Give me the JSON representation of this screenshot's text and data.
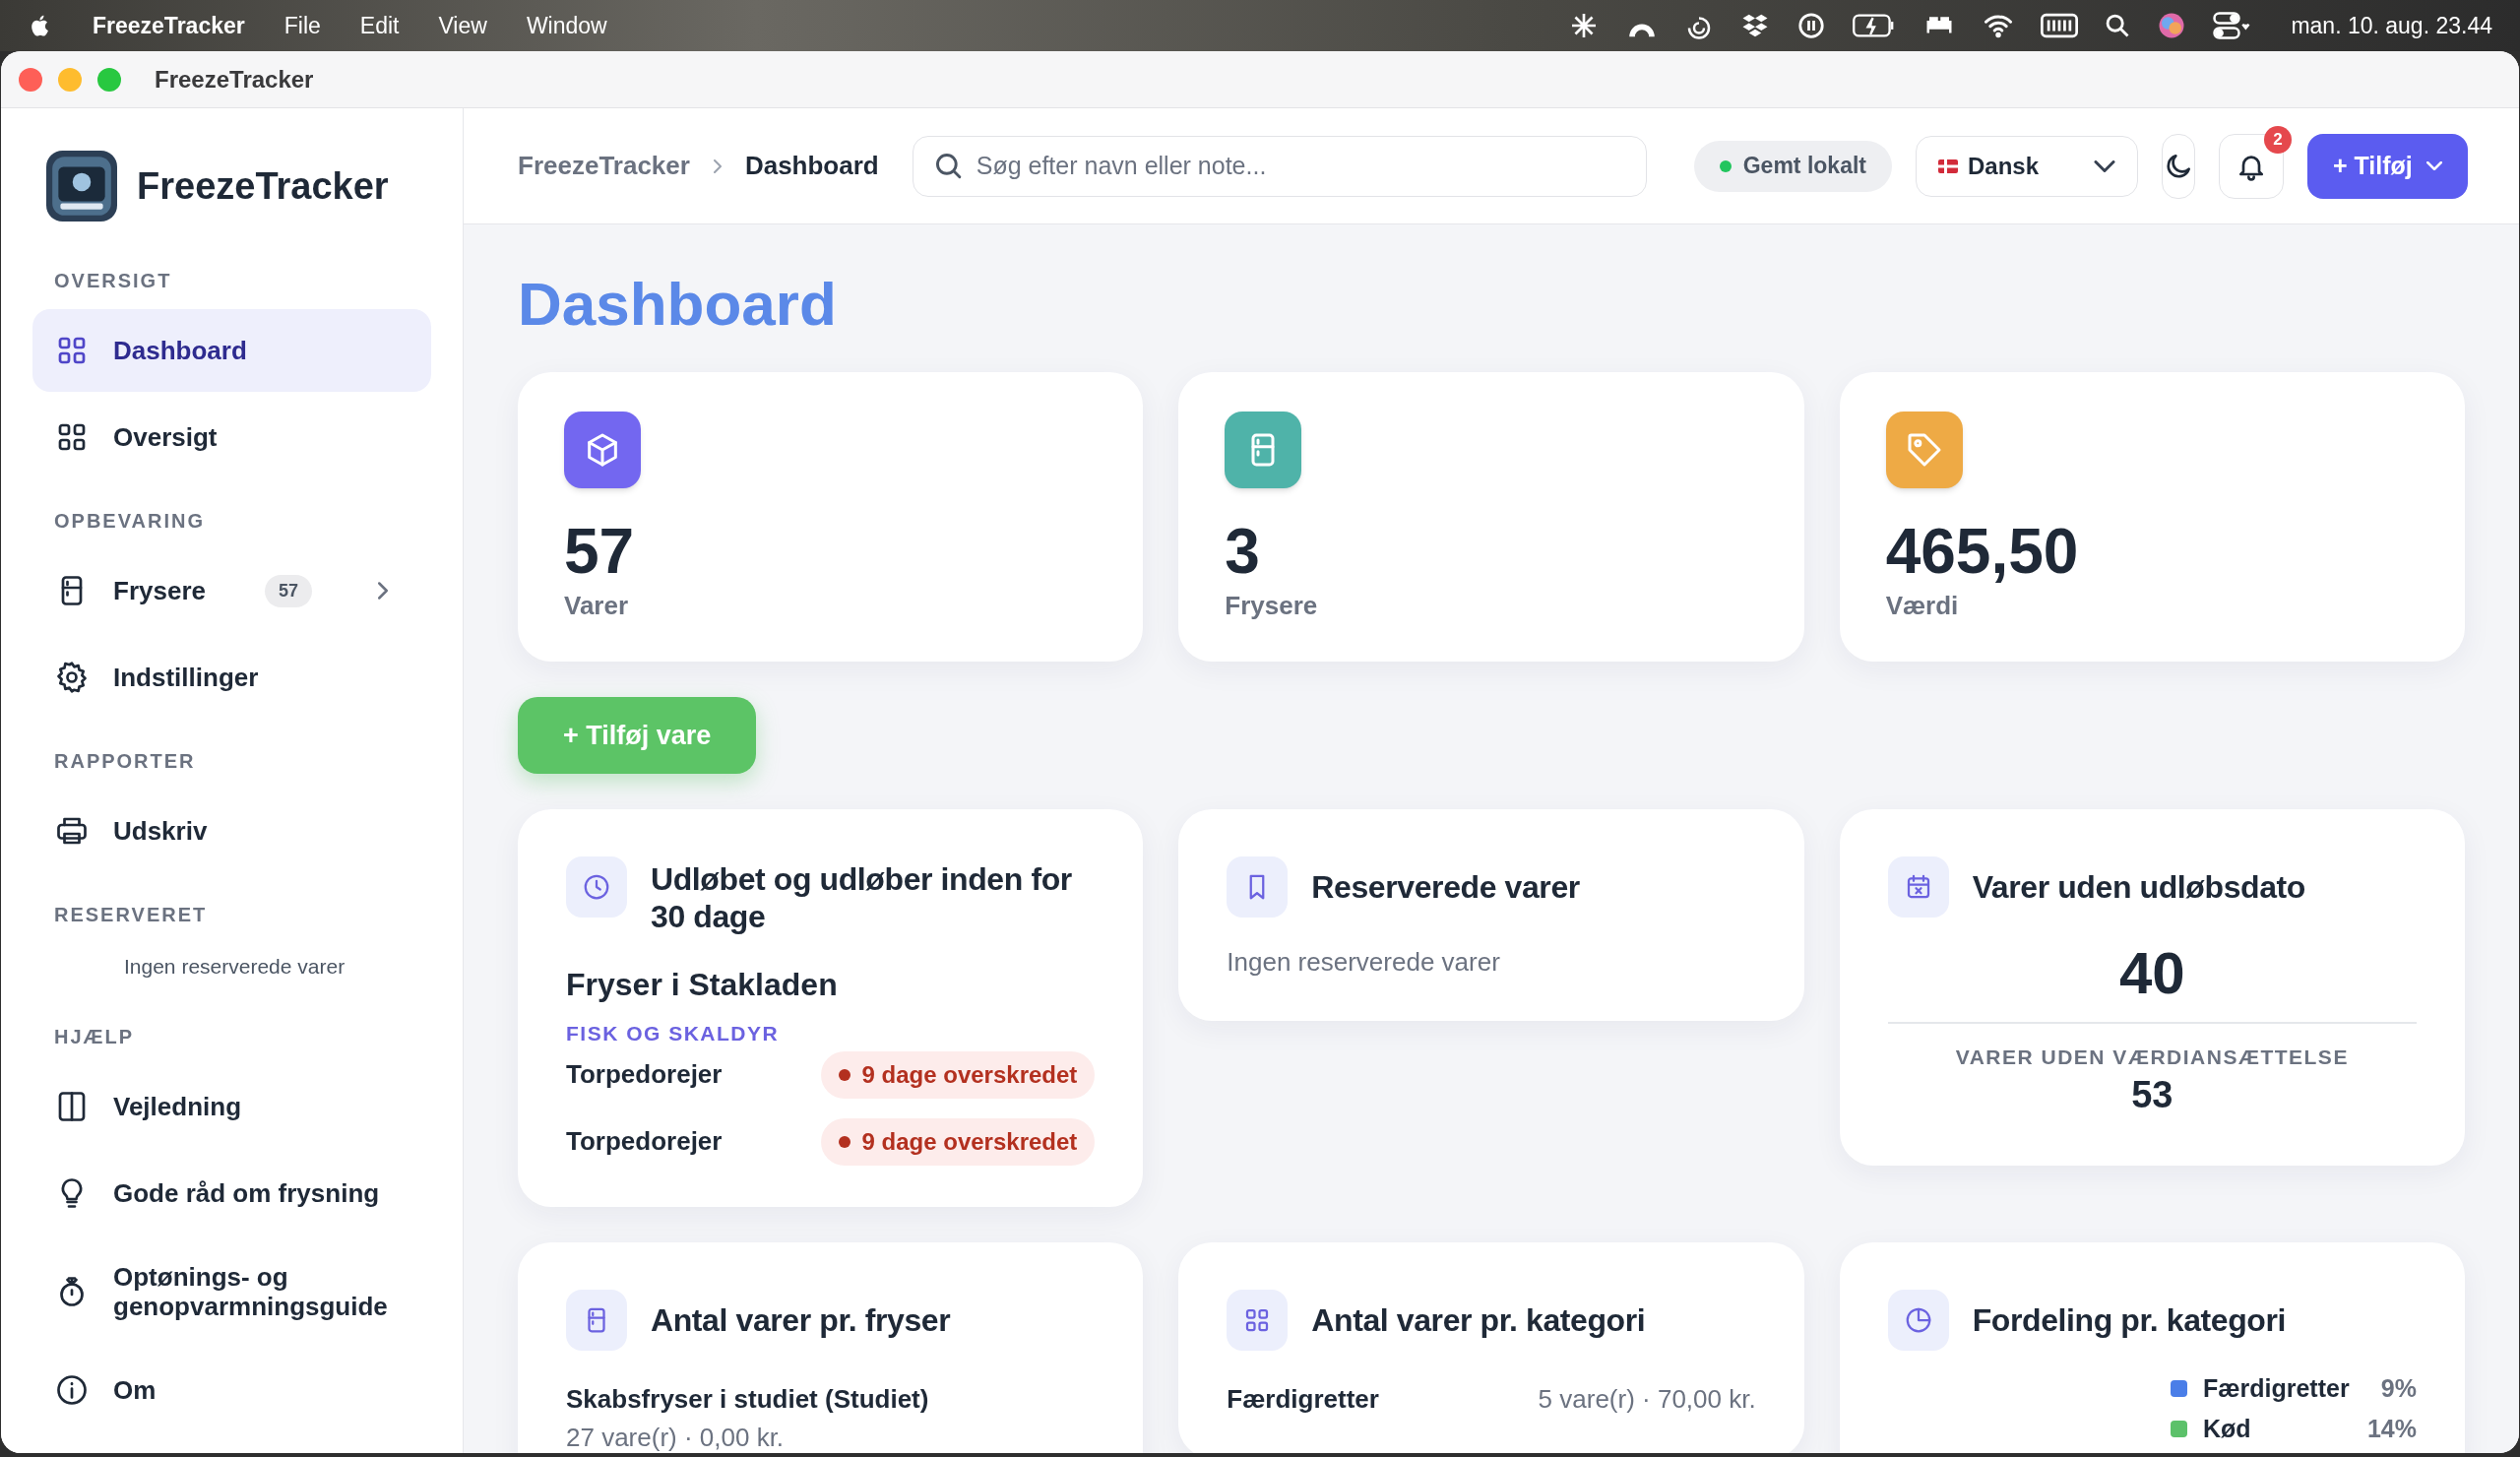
{
  "menubar": {
    "app": "FreezeTracker",
    "menus": [
      "File",
      "Edit",
      "View",
      "Window"
    ],
    "clock": "man. 10. aug. 23.44"
  },
  "window": {
    "title": "FreezeTracker"
  },
  "sidebar": {
    "app_name": "FreezeTracker",
    "sections": [
      {
        "heading": "OVERSIGT",
        "items": [
          {
            "label": "Dashboard",
            "selected": true,
            "expandable": false
          },
          {
            "label": "Oversigt",
            "selected": false,
            "expandable": false
          }
        ]
      },
      {
        "heading": "OPBEVARING",
        "items": [
          {
            "label": "Frysere",
            "selected": false,
            "expandable": true,
            "badge": "57"
          },
          {
            "label": "Indstillinger",
            "selected": false,
            "expandable": false
          }
        ]
      },
      {
        "heading": "RAPPORTER",
        "items": [
          {
            "label": "Udskriv",
            "selected": false,
            "expandable": false
          }
        ]
      },
      {
        "heading": "RESERVERET",
        "empty_text": "Ingen reserverede varer"
      },
      {
        "heading": "HJÆLP",
        "items": [
          {
            "label": "Vejledning",
            "selected": false,
            "expandable": false
          },
          {
            "label": "Gode råd om frysning",
            "selected": false,
            "expandable": false
          },
          {
            "label": "Optønings- og genopvarmningsguide",
            "selected": false,
            "expandable": false
          },
          {
            "label": "Om",
            "selected": false,
            "expandable": false
          }
        ]
      }
    ]
  },
  "header": {
    "breadcrumb": [
      "FreezeTracker",
      "Dashboard"
    ],
    "search": {
      "placeholder": "Søg efter navn eller note..."
    },
    "save_status": "Gemt lokalt",
    "language": "Dansk",
    "notifications": "2",
    "add_button": "+ Tilføj"
  },
  "page_title": "Dashboard",
  "stats": [
    {
      "value": "57",
      "label": "Varer",
      "color": "#7367f0"
    },
    {
      "value": "3",
      "label": "Frysere",
      "color": "#4fb3a9"
    },
    {
      "value": "465,50",
      "label": "Værdi",
      "color": "#eeaa45"
    }
  ],
  "add_item_button": "+ Tilføj vare",
  "expiring": {
    "title": "Udløbet og udløber inden for 30 dage",
    "groups": [
      {
        "freezer": "Fryser i Stakladen",
        "category": "FISK OG SKALDYR",
        "items": [
          {
            "name": "Torpedorejer",
            "status": "9 dage overskredet"
          },
          {
            "name": "Torpedorejer",
            "status": "9 dage overskredet"
          }
        ]
      }
    ]
  },
  "reserved": {
    "title": "Reserverede varer",
    "empty_text": "Ingen reserverede varer"
  },
  "no_expiry": {
    "title": "Varer uden udløbsdato",
    "count": "40",
    "sub_label": "VARER UDEN VÆRDIANSÆTTELSE",
    "sub_count": "53"
  },
  "per_freezer": {
    "title": "Antal varer pr. fryser",
    "rows": [
      {
        "name": "Skabsfryser i studiet (Studiet)",
        "detail": "27 vare(r) · 0,00 kr."
      }
    ]
  },
  "per_category": {
    "title": "Antal varer pr. kategori",
    "rows": [
      {
        "name": "Færdigretter",
        "detail": "5 vare(r) · 70,00 kr."
      }
    ]
  },
  "distribution": {
    "title": "Fordeling pr. kategori",
    "legend": [
      {
        "label": "Færdigretter",
        "share": "9%",
        "color": "#4a7ee8"
      },
      {
        "label": "Kød",
        "share": "14%",
        "color": "#5cc16a"
      }
    ]
  }
}
